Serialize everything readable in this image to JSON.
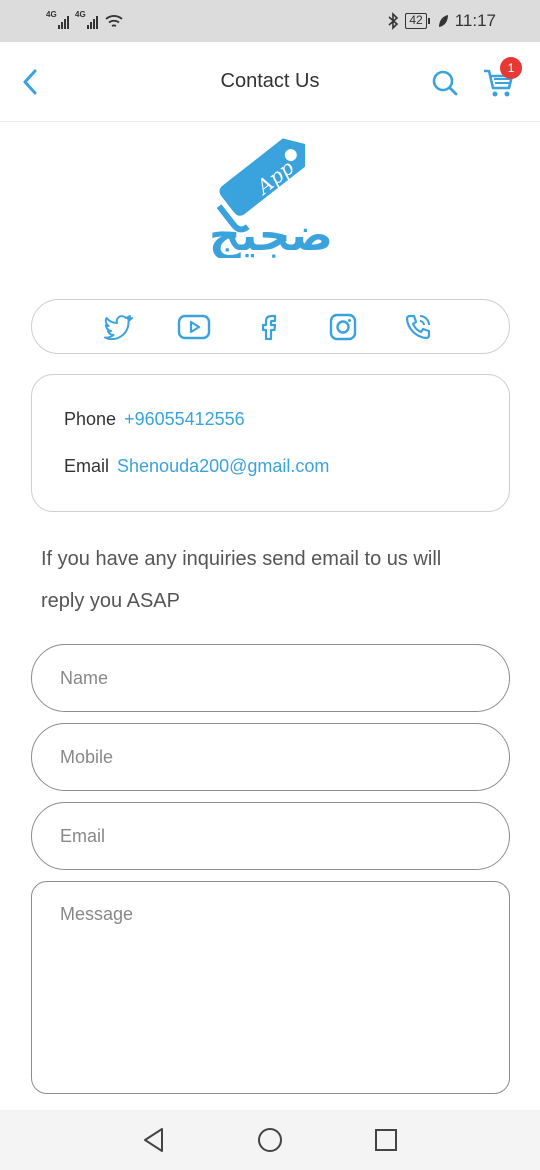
{
  "status_bar": {
    "network_1": "4G",
    "network_2": "4G",
    "battery": "42",
    "time": "11:17"
  },
  "header": {
    "title": "Contact Us",
    "cart_count": "1"
  },
  "logo": {
    "tag_text": "App",
    "script_text": "ضجيج"
  },
  "social": [
    "twitter-icon",
    "youtube-icon",
    "facebook-icon",
    "instagram-icon",
    "phone-call-icon"
  ],
  "contact_info": {
    "phone_label": "Phone",
    "phone_value": "+96055412556",
    "email_label": "Email",
    "email_value": "Shenouda200@gmail.com"
  },
  "inquiry_text": "If you have any inquiries send email to us will reply you ASAP",
  "form": {
    "name_placeholder": "Name",
    "mobile_placeholder": "Mobile",
    "email_placeholder": "Email",
    "message_placeholder": "Message"
  },
  "colors": {
    "accent": "#3aa3dd",
    "badge": "#e53935"
  }
}
